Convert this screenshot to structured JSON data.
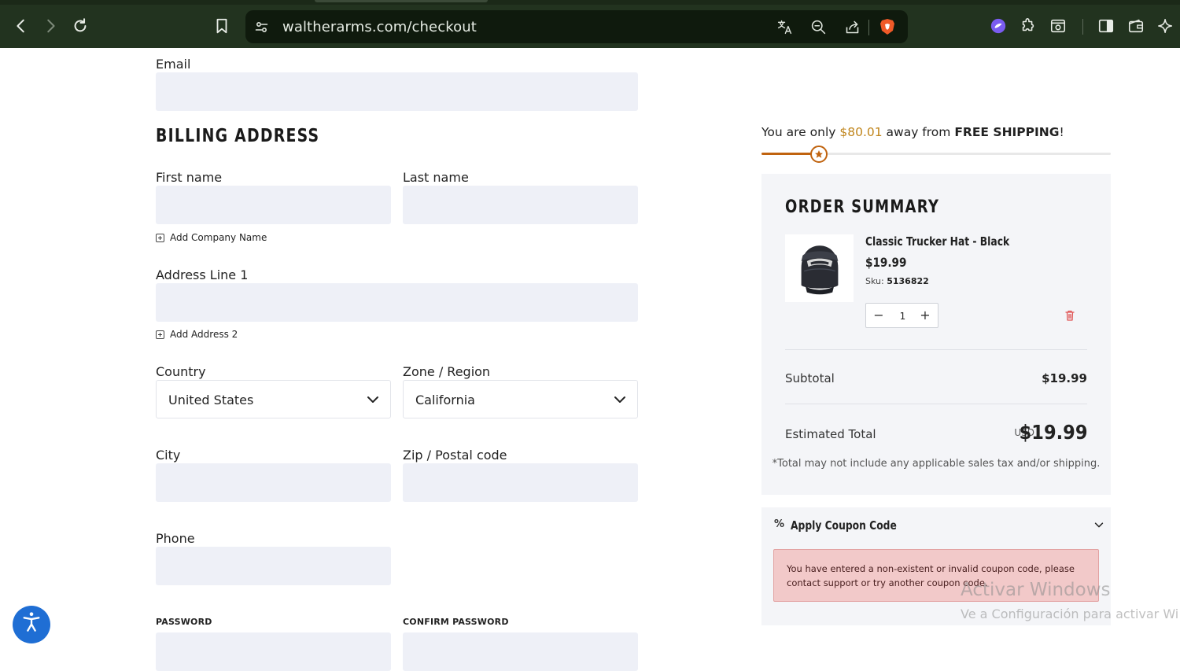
{
  "browser": {
    "url": "waltherarms.com/checkout",
    "icons": [
      "back-icon",
      "forward-icon",
      "reload-icon",
      "bookmark-icon",
      "site-settings-icon",
      "translate-icon",
      "zoom-out-icon",
      "share-icon",
      "brave-shields-icon",
      "leo-ai-icon",
      "extensions-icon",
      "screenshot-icon",
      "sidebar-icon",
      "wallet-icon",
      "sparkle-icon"
    ]
  },
  "form": {
    "email_label": "Email",
    "billing_heading": "BILLING ADDRESS",
    "first_name_label": "First name",
    "last_name_label": "Last name",
    "add_company": "Add Company Name",
    "address1_label": "Address Line 1",
    "add_address2": "Add Address 2",
    "country_label": "Country",
    "country_value": "United States",
    "region_label": "Zone / Region",
    "region_value": "California",
    "city_label": "City",
    "zip_label": "Zip / Postal code",
    "phone_label": "Phone",
    "password_label": "PASSWORD",
    "confirm_password_label": "CONFIRM PASSWORD"
  },
  "shipping": {
    "prefix": "You are only ",
    "amount": "$80.01",
    "middle": " away from ",
    "bold": "FREE SHIPPING",
    "suffix": "!",
    "progress_fraction": 0.165
  },
  "summary": {
    "heading": "ORDER SUMMARY",
    "product_name": "Classic Trucker Hat - Black",
    "product_price": "$19.99",
    "sku_label": "Sku: ",
    "sku": "5136822",
    "quantity": "1",
    "minus": "−",
    "plus": "+",
    "subtotal_label": "Subtotal",
    "subtotal_value": "$19.99",
    "total_label": "Estimated Total",
    "currency": "USD",
    "total_value": "$19.99",
    "note": "*Total may not include any applicable sales tax and/or shipping."
  },
  "coupon": {
    "title": "Apply Coupon Code",
    "icon_text": "%",
    "error": "You have entered a non-existent or invalid coupon code, please contact support or try another coupon code."
  },
  "watermark": {
    "line1": "Activar Windows",
    "line2": "Ve a Configuración para activar Wi"
  },
  "colors": {
    "chrome": "#22331f",
    "field": "#eef0f7",
    "accent": "#c0630f",
    "amount": "#c0851b",
    "error_bg": "#f2c9c9"
  }
}
